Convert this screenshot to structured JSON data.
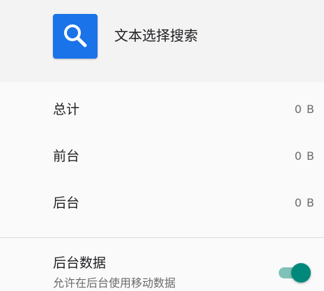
{
  "app": {
    "name": "文本选择搜索",
    "icon": "search-icon",
    "icon_color": "#1a73e8"
  },
  "usage": {
    "rows": [
      {
        "label": "总计",
        "value": "0 B"
      },
      {
        "label": "前台",
        "value": "0 B"
      },
      {
        "label": "后台",
        "value": "0 B"
      }
    ]
  },
  "background_data": {
    "title": "后台数据",
    "subtitle": "允许在后台使用移动数据",
    "enabled": true,
    "accent_color": "#00897b"
  }
}
